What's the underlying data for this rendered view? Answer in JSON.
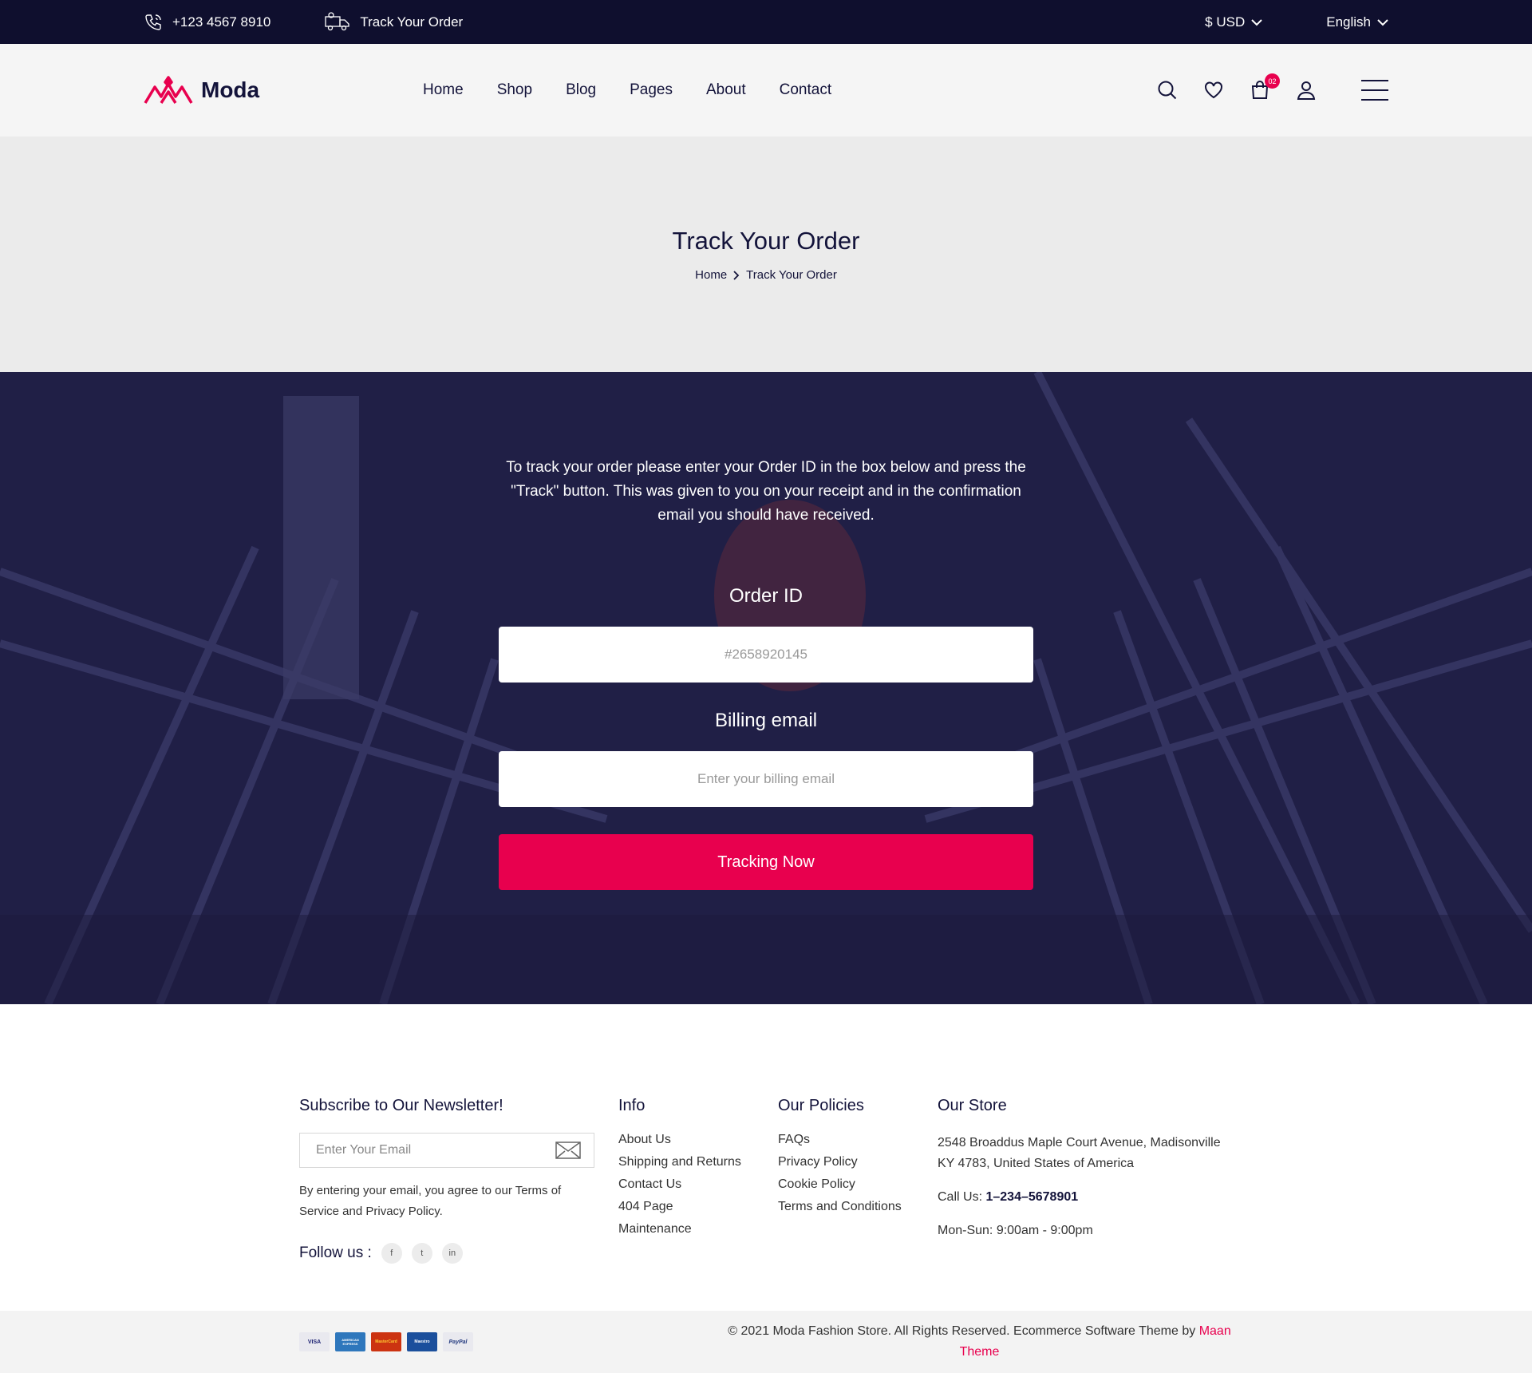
{
  "topbar": {
    "phone": "+123 4567 8910",
    "track_label": "Track Your Order",
    "currency": "$ USD",
    "language": "English"
  },
  "header": {
    "logo_text": "Moda",
    "nav": [
      "Home",
      "Shop",
      "Blog",
      "Pages",
      "About",
      "Contact"
    ],
    "cart_count": "02"
  },
  "banner": {
    "title": "Track Your Order",
    "breadcrumb_home": "Home",
    "breadcrumb_current": "Track Your Order"
  },
  "track": {
    "description": "To track your order please enter your Order ID in the box below and press the \"Track\" button. This was given to you on your receipt and in the confirmation email you should have received.",
    "order_label": "Order ID",
    "order_placeholder": "#2658920145",
    "email_label": "Billing email",
    "email_placeholder": "Enter your billing email",
    "button": "Tracking Now"
  },
  "footer": {
    "newsletter_title": "Subscribe to Our Newsletter!",
    "newsletter_placeholder": "Enter Your Email",
    "newsletter_note": "By entering your email, you agree to our Terms of Service and Privacy Policy.",
    "follow_label": "Follow us :",
    "social": [
      "f",
      "t",
      "in"
    ],
    "info_title": "Info",
    "info_links": [
      "About Us",
      "Shipping and Returns",
      "Contact Us",
      "404 Page",
      "Maintenance"
    ],
    "policies_title": "Our Policies",
    "policy_links": [
      "FAQs",
      "Privacy Policy",
      "Cookie Policy",
      "Terms and Conditions"
    ],
    "store_title": "Our Store",
    "store_address": "2548 Broaddus Maple Court Avenue, Madisonville KY 4783, United States of America",
    "call_label": "Call Us:",
    "call_number": "1–234–5678901",
    "hours": "Mon-Sun: 9:00am - 9:00pm"
  },
  "bottom": {
    "cards": [
      "VISA",
      "AMERICAN EXPRESS",
      "MasterCard",
      "Maestro",
      "PayPal"
    ],
    "copyright": "© 2021 Moda Fashion Store. All Rights Reserved. Ecommerce Software Theme by",
    "brand": "Maan Theme"
  },
  "colors": {
    "accent": "#e8004e",
    "dark": "#0f0f2e",
    "overlay": "#24234d"
  }
}
